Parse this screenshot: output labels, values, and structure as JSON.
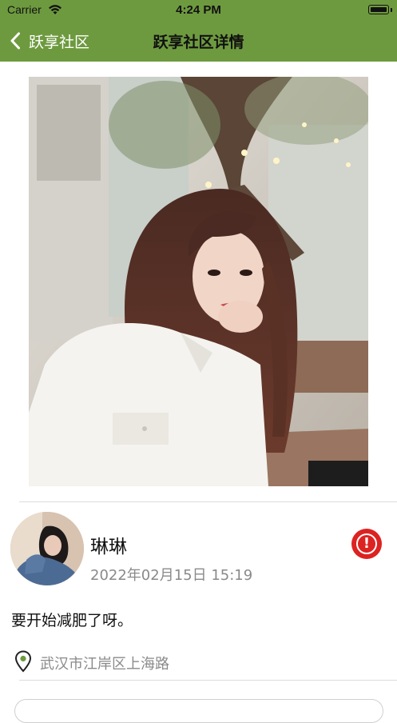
{
  "status_bar": {
    "carrier": "Carrier",
    "time": "4:24 PM"
  },
  "nav": {
    "back_label": "跃享社区",
    "title": "跃享社区详情"
  },
  "post": {
    "author_name": "琳琳",
    "date": "2022年02月15日  15:19",
    "content": "要开始减肥了呀。",
    "location": "武汉市江岸区上海路"
  },
  "icons": {
    "back": "chevron-left-icon",
    "report": "exclamation-icon",
    "location": "map-pin-icon",
    "wifi": "wifi-icon",
    "battery": "battery-icon"
  },
  "colors": {
    "header": "#6e9a3f",
    "report": "#dd2222",
    "secondary_text": "#8a8a8a"
  }
}
